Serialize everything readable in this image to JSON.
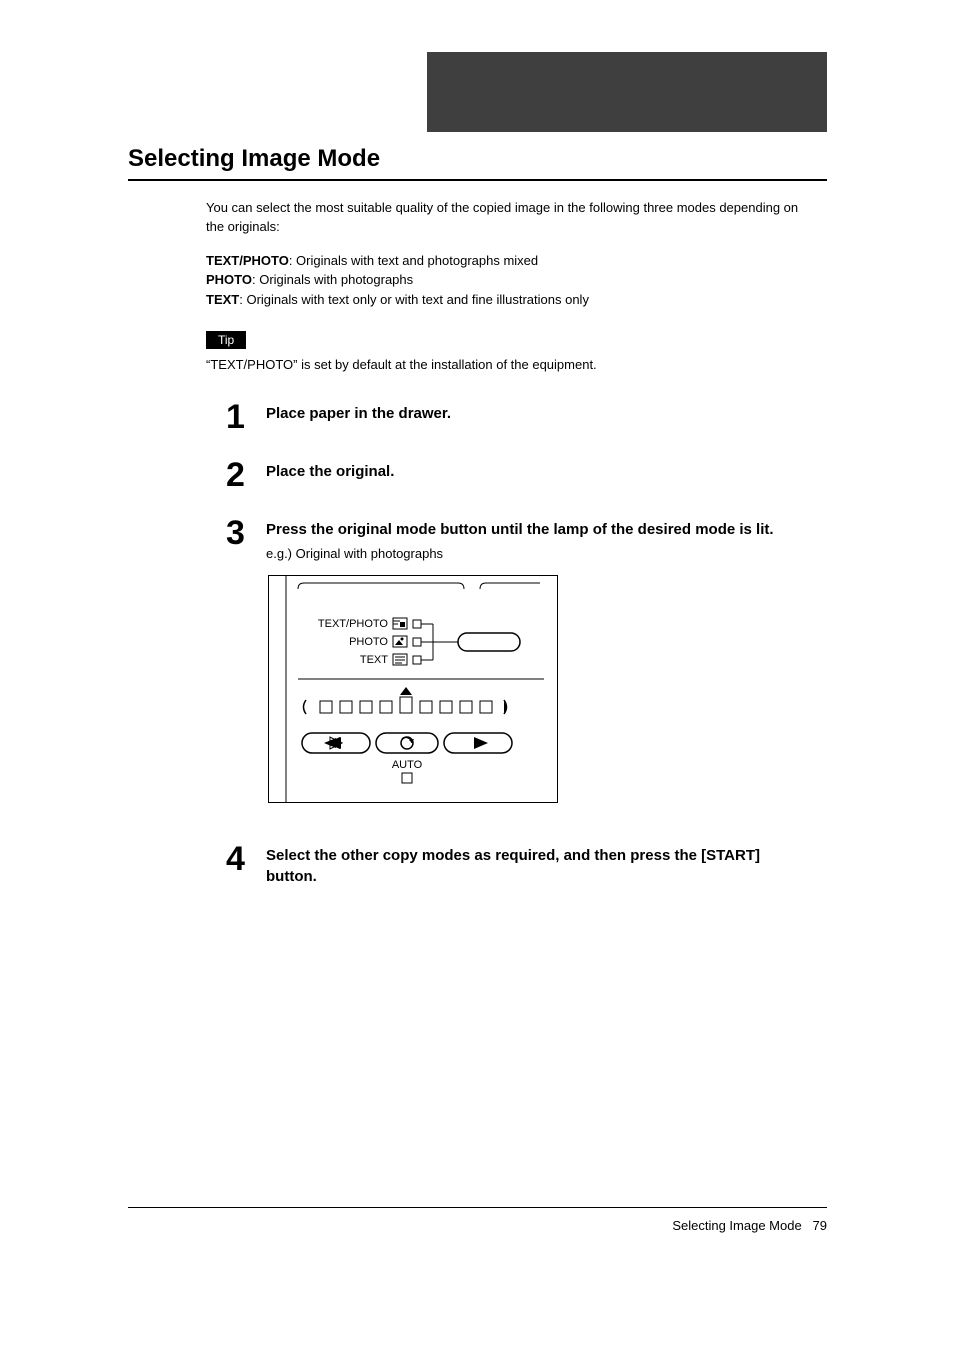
{
  "header": {
    "title": "Selecting Image Mode"
  },
  "intro": "You can select the most suitable quality of the copied image in the following three modes depending on the originals:",
  "defs": {
    "d1_label": "TEXT/PHOTO",
    "d1_text": ": Originals with text and photographs mixed",
    "d2_label": "PHOTO",
    "d2_text": ": Originals with photographs",
    "d3_label": "TEXT",
    "d3_text": ": Originals with text only or with text and fine illustrations only"
  },
  "tip": {
    "label": "Tip",
    "text": "“TEXT/PHOTO” is set by default at the installation of the equipment."
  },
  "steps": {
    "s1": {
      "num": "1",
      "title": "Place paper in the drawer."
    },
    "s2": {
      "num": "2",
      "title": "Place the original."
    },
    "s3": {
      "num": "3",
      "title": "Press the original mode button until the lamp of the desired mode is lit.",
      "sub": "e.g.) Original with photographs"
    },
    "s4": {
      "num": "4",
      "title": "Select the other copy modes as required, and then press the [START] button."
    }
  },
  "panel": {
    "mode1": "TEXT/PHOTO",
    "mode2": "PHOTO",
    "mode3": "TEXT",
    "auto": "AUTO"
  },
  "footer": {
    "label": "Selecting Image Mode",
    "page": "79"
  }
}
